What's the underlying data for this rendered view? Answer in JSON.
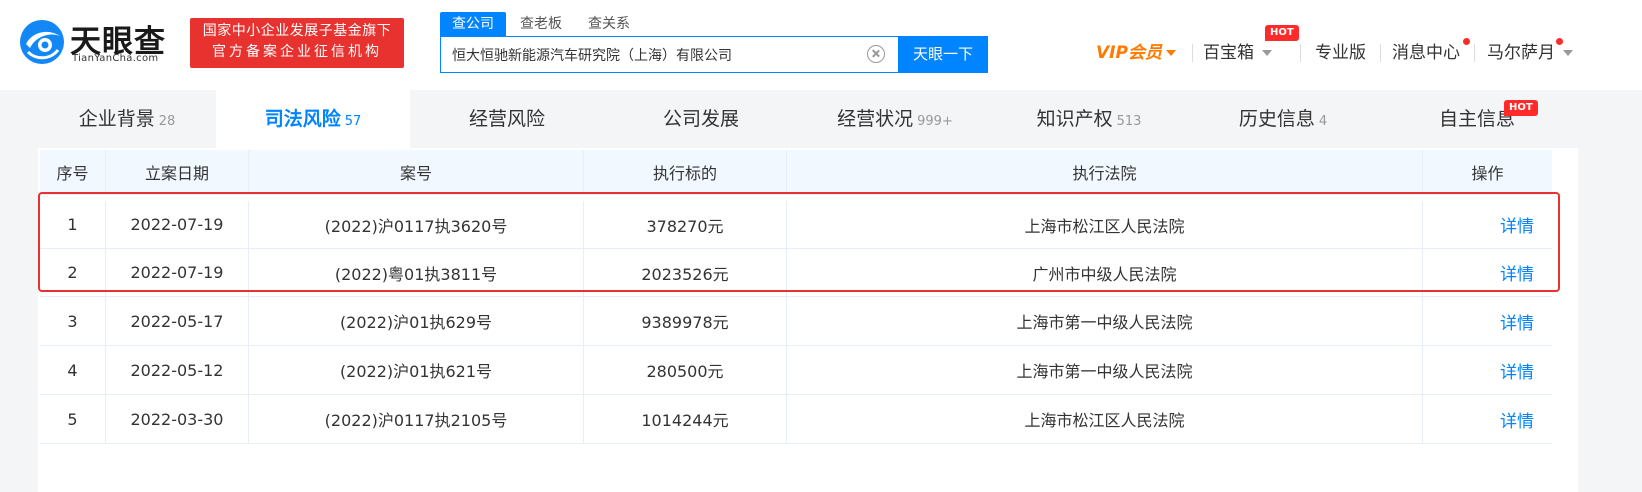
{
  "header": {
    "logo_cn": "天眼查",
    "logo_en": "TianYanCha.com",
    "slogan_line1": "国家中小企业发展子基金旗下",
    "slogan_line2": "官方备案企业征信机构",
    "search_tabs": [
      "查公司",
      "查老板",
      "查关系"
    ],
    "search_value": "恒大恒驰新能源汽车研究院（上海）有限公司",
    "search_button": "天眼一下",
    "nav": {
      "vip": "VIP会员",
      "toolbox": "百宝箱",
      "toolbox_badge": "HOT",
      "pro": "专业版",
      "messages": "消息中心",
      "user": "马尔萨月"
    }
  },
  "tabs": [
    {
      "label": "企业背景",
      "count": "28"
    },
    {
      "label": "司法风险",
      "count": "57"
    },
    {
      "label": "经营风险",
      "count": ""
    },
    {
      "label": "公司发展",
      "count": ""
    },
    {
      "label": "经营状况",
      "count": "999+"
    },
    {
      "label": "知识产权",
      "count": "513"
    },
    {
      "label": "历史信息",
      "count": "4"
    },
    {
      "label": "自主信息",
      "count": ""
    }
  ],
  "tab_hot_badge": "HOT",
  "table": {
    "headers": [
      "序号",
      "立案日期",
      "案号",
      "执行标的",
      "执行法院",
      "操作"
    ],
    "rows": [
      [
        "1",
        "2022-07-19",
        "(2022)沪0117执3620号",
        "378270元",
        "上海市松江区人民法院",
        "详情"
      ],
      [
        "2",
        "2022-07-19",
        "(2022)粤01执3811号",
        "2023526元",
        "广州市中级人民法院",
        "详情"
      ],
      [
        "3",
        "2022-05-17",
        "(2022)沪01执629号",
        "9389978元",
        "上海市第一中级人民法院",
        "详情"
      ],
      [
        "4",
        "2022-05-12",
        "(2022)沪01执621号",
        "280500元",
        "上海市第一中级人民法院",
        "详情"
      ],
      [
        "5",
        "2022-03-30",
        "(2022)沪0117执2105号",
        "1014244元",
        "上海市松江区人民法院",
        "详情"
      ]
    ]
  },
  "colors": {
    "accent": "#0084ff",
    "slogan_bg": "#e8322f",
    "vip": "#ff7a00",
    "highlight": "#e8322f"
  }
}
